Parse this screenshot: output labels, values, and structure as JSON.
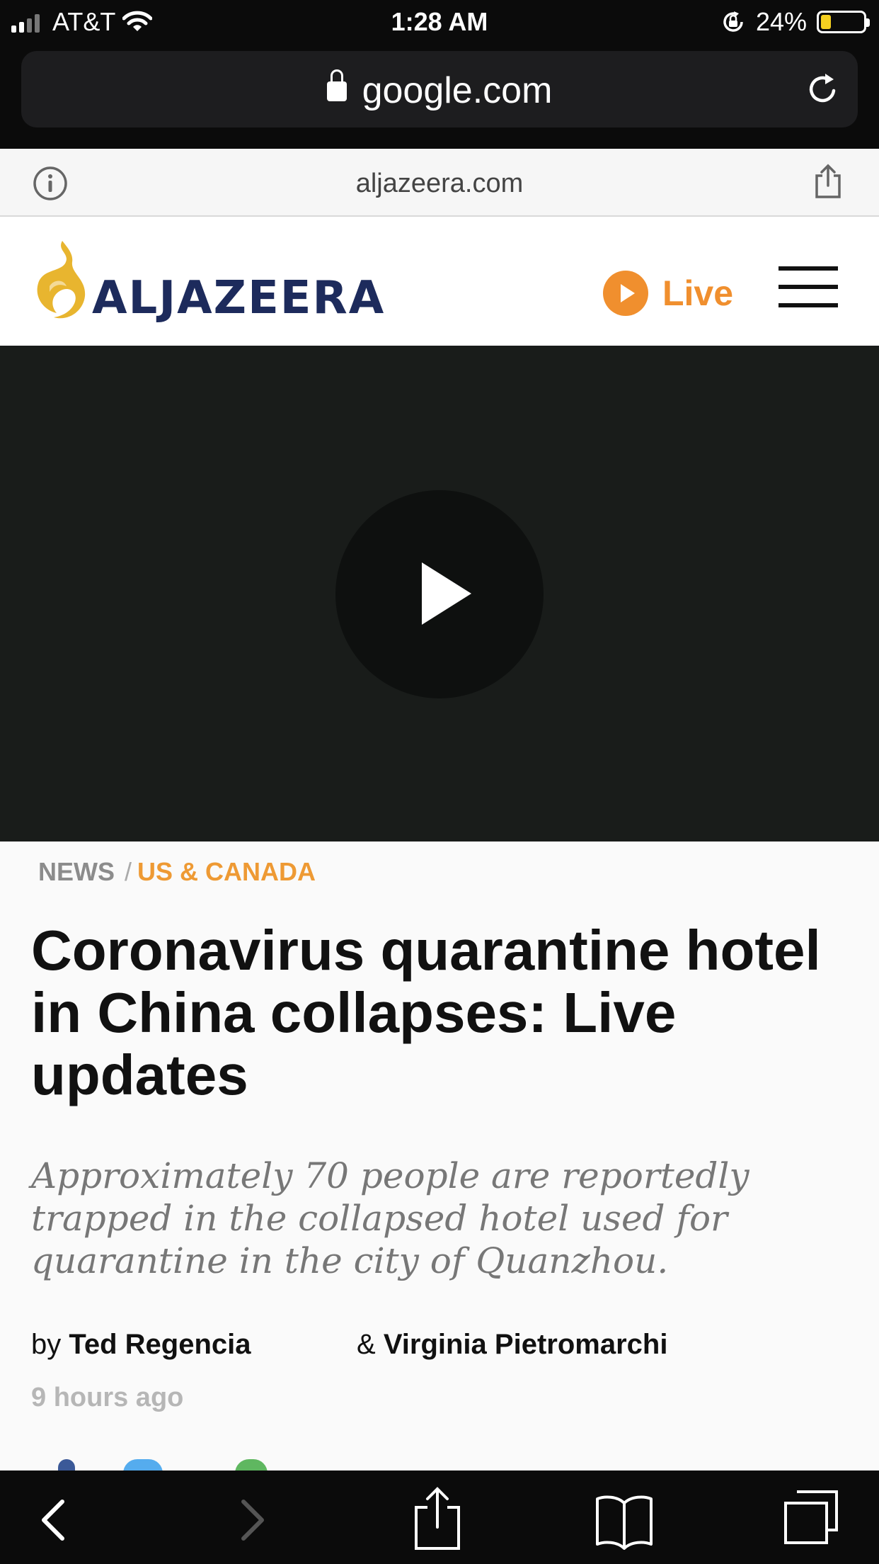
{
  "status_bar": {
    "carrier": "AT&T",
    "time": "1:28 AM",
    "battery_percent": "24%",
    "battery_level": 0.24,
    "battery_color": "#f5d020"
  },
  "browser": {
    "url": "google.com",
    "site_domain": "aljazeera.com",
    "icons": [
      "lock-icon",
      "reload-icon",
      "info-icon",
      "share-icon"
    ]
  },
  "header": {
    "logo_text": "ALJAZEERA",
    "live_label": "Live",
    "brand_color": "#1d2b5c",
    "accent_color": "#f08f2e"
  },
  "video": {
    "icon": "play-icon"
  },
  "article": {
    "breadcrumb": {
      "section": "NEWS",
      "separator": "/",
      "category": "US & CANADA"
    },
    "headline": "Coronavirus quarantine hotel in China collapses: Live updates",
    "summary": "Approximately 70 people are reportedly trapped in the collapsed hotel used for quarantine in the city of Quanzhou.",
    "byline": {
      "by": "by",
      "author1": "Ted Regencia",
      "amp": "&",
      "author2": "Virginia Pietromarchi"
    },
    "timestamp": "9 hours ago"
  },
  "toolbar": {
    "icons": [
      "back-icon",
      "forward-icon",
      "share-icon",
      "bookmarks-icon",
      "tabs-icon"
    ]
  }
}
